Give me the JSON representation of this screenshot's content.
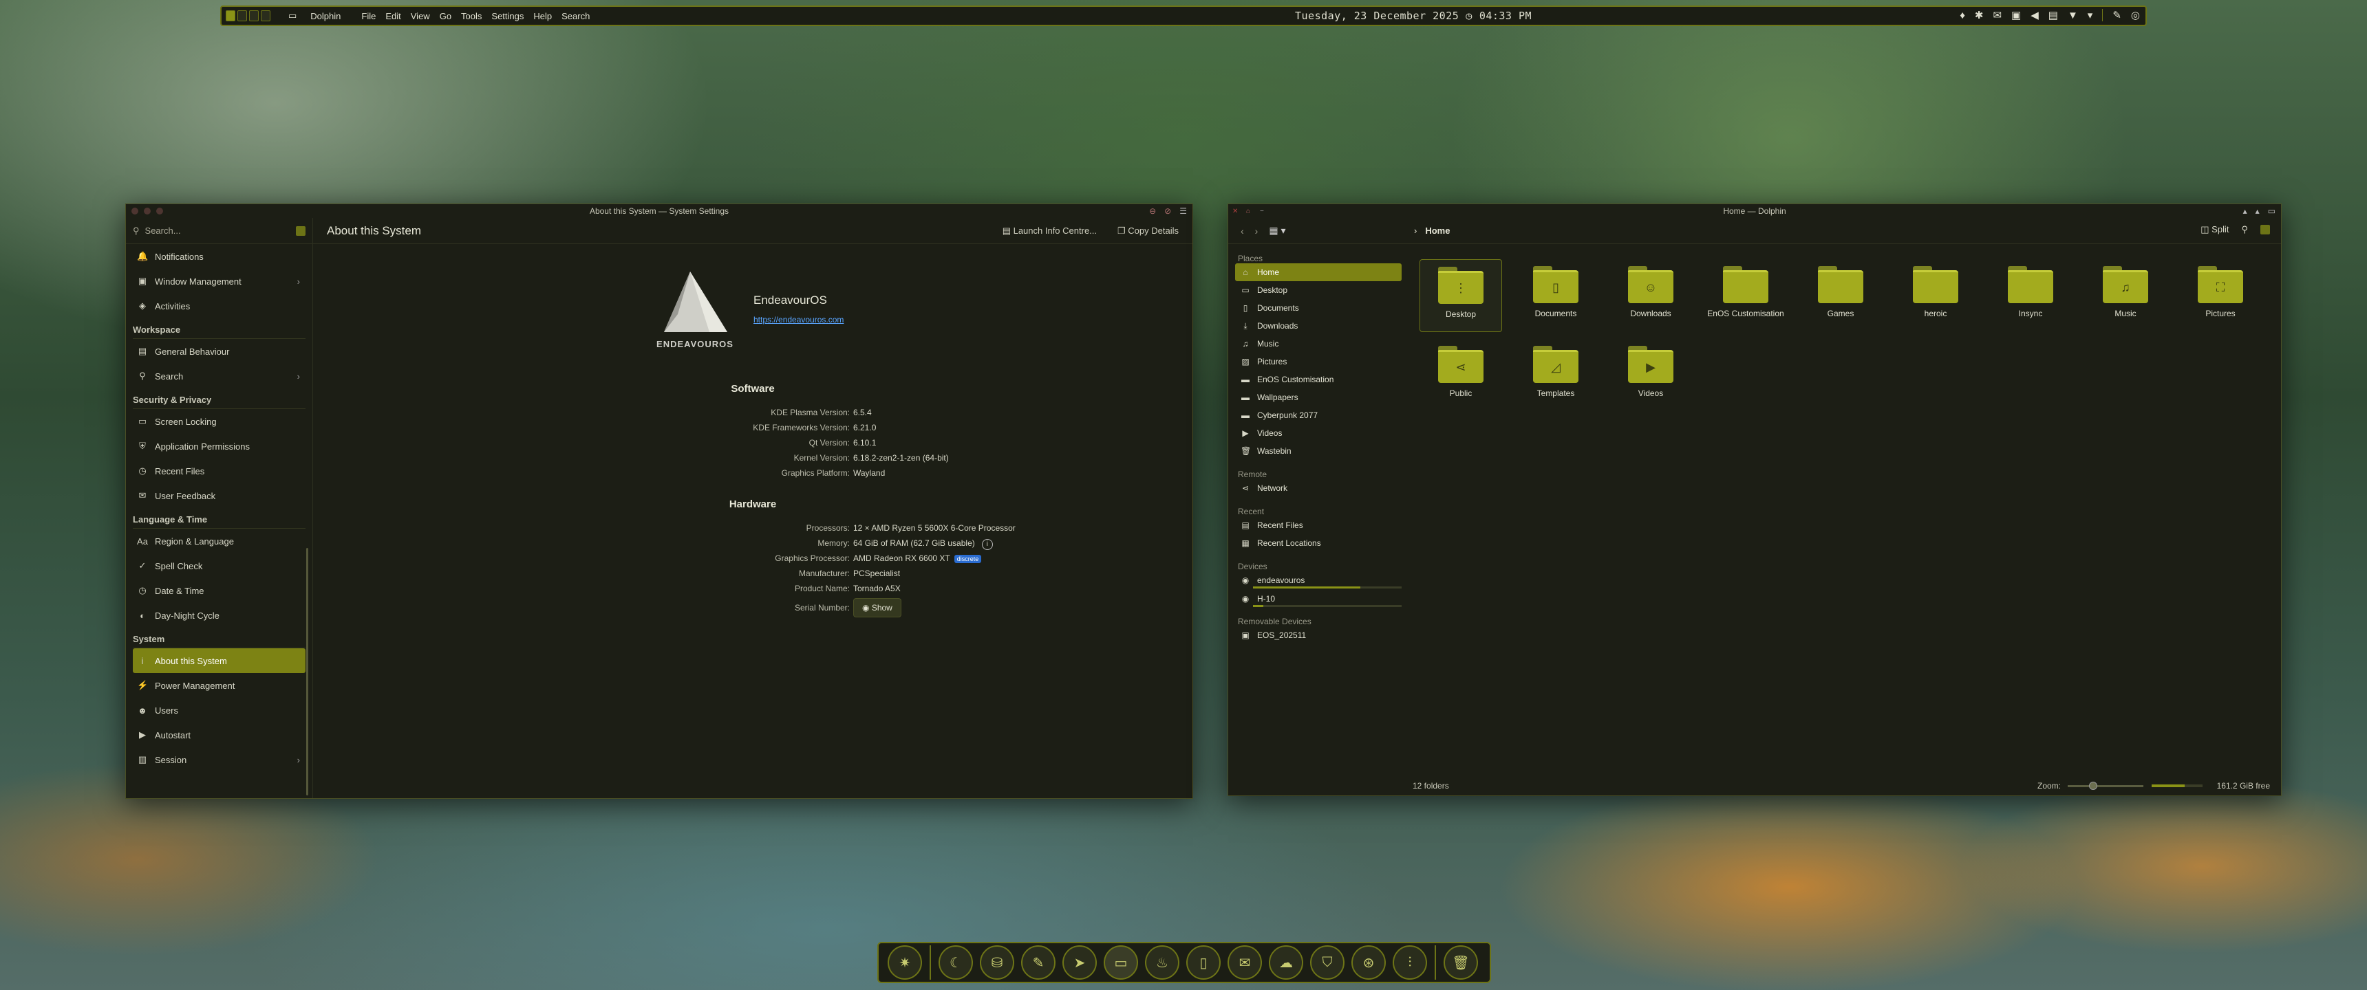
{
  "topbar": {
    "app_name": "Dolphin",
    "menu": [
      "File",
      "Edit",
      "View",
      "Go",
      "Tools",
      "Settings",
      "Help",
      "Search"
    ],
    "date": "Tuesday, 23 December 2025",
    "time": "04:33 PM"
  },
  "settings": {
    "window_title": "About this System — System Settings",
    "search_placeholder": "Search...",
    "page_title": "About this System",
    "launch_info": "Launch Info Centre...",
    "copy_details": "Copy Details",
    "sidebar": {
      "items_top": [
        {
          "label": "Notifications",
          "icon": "bell-icon"
        },
        {
          "label": "Window Management",
          "icon": "window-icon",
          "arrow": true
        },
        {
          "label": "Activities",
          "icon": "activities-icon"
        }
      ],
      "workspace_header": "Workspace",
      "workspace": [
        {
          "label": "General Behaviour",
          "icon": "general-icon"
        },
        {
          "label": "Search",
          "icon": "search-icon",
          "arrow": true
        }
      ],
      "security_header": "Security & Privacy",
      "security": [
        {
          "label": "Screen Locking",
          "icon": "screen-lock-icon"
        },
        {
          "label": "Application Permissions",
          "icon": "shield-icon"
        },
        {
          "label": "Recent Files",
          "icon": "clock-icon"
        },
        {
          "label": "User Feedback",
          "icon": "feedback-icon"
        }
      ],
      "language_header": "Language & Time",
      "language": [
        {
          "label": "Region & Language",
          "icon": "language-icon"
        },
        {
          "label": "Spell Check",
          "icon": "spell-icon"
        },
        {
          "label": "Date & Time",
          "icon": "clock-icon"
        },
        {
          "label": "Day-Night Cycle",
          "icon": "day-night-icon"
        }
      ],
      "system_header": "System",
      "system": [
        {
          "label": "About this System",
          "icon": "info-icon",
          "active": true
        },
        {
          "label": "Power Management",
          "icon": "power-icon"
        },
        {
          "label": "Users",
          "icon": "users-icon"
        },
        {
          "label": "Autostart",
          "icon": "autostart-icon"
        },
        {
          "label": "Session",
          "icon": "session-icon",
          "arrow": true
        }
      ]
    },
    "os_name": "EndeavourOS",
    "os_url": "https://endeavouros.com",
    "logo_text": "ENDEAVOUROS",
    "software_header": "Software",
    "software": [
      {
        "k": "KDE Plasma Version:",
        "v": "6.5.4"
      },
      {
        "k": "KDE Frameworks Version:",
        "v": "6.21.0"
      },
      {
        "k": "Qt Version:",
        "v": "6.10.1"
      },
      {
        "k": "Kernel Version:",
        "v": "6.18.2-zen2-1-zen (64-bit)"
      },
      {
        "k": "Graphics Platform:",
        "v": "Wayland"
      }
    ],
    "hardware_header": "Hardware",
    "hardware": {
      "processors_k": "Processors:",
      "processors_v": "12 × AMD Ryzen 5 5600X 6-Core Processor",
      "memory_k": "Memory:",
      "memory_v": "64 GiB of RAM (62.7 GiB usable)",
      "gpu_k": "Graphics Processor:",
      "gpu_v": "AMD Radeon RX 6600 XT",
      "gpu_badge": "discrete",
      "manufacturer_k": "Manufacturer:",
      "manufacturer_v": "PCSpecialist",
      "product_k": "Product Name:",
      "product_v": "Tornado A5X",
      "serial_k": "Serial Number:",
      "serial_btn": "Show"
    }
  },
  "dolphin": {
    "window_title": "Home — Dolphin",
    "breadcrumb": "Home",
    "split_label": "Split",
    "places_header": "Places",
    "places": [
      {
        "label": "Home",
        "icon": "home-icon",
        "active": true
      },
      {
        "label": "Desktop",
        "icon": "desktop-icon"
      },
      {
        "label": "Documents",
        "icon": "documents-icon"
      },
      {
        "label": "Downloads",
        "icon": "downloads-icon"
      },
      {
        "label": "Music",
        "icon": "music-icon"
      },
      {
        "label": "Pictures",
        "icon": "pictures-icon"
      },
      {
        "label": "EnOS Customisation",
        "icon": "folder-icon"
      },
      {
        "label": "Wallpapers",
        "icon": "folder-icon"
      },
      {
        "label": "Cyberpunk 2077",
        "icon": "folder-icon"
      },
      {
        "label": "Videos",
        "icon": "videos-icon"
      },
      {
        "label": "Wastebin",
        "icon": "trash-icon"
      }
    ],
    "remote_header": "Remote",
    "remote": [
      {
        "label": "Network",
        "icon": "network-icon"
      }
    ],
    "recent_header": "Recent",
    "recent": [
      {
        "label": "Recent Files",
        "icon": "recent-files-icon"
      },
      {
        "label": "Recent Locations",
        "icon": "recent-locations-icon"
      }
    ],
    "devices_header": "Devices",
    "devices": [
      {
        "label": "endeavouros",
        "icon": "drive-icon",
        "used": 0.72
      },
      {
        "label": "H-10",
        "icon": "drive-icon",
        "used": 0.07
      }
    ],
    "removable_header": "Removable Devices",
    "removable": [
      {
        "label": "EOS_202511",
        "icon": "usb-icon"
      }
    ],
    "folders": [
      {
        "name": "Desktop",
        "glyph": "⋮",
        "selected": true
      },
      {
        "name": "Documents",
        "glyph": "▯"
      },
      {
        "name": "Downloads",
        "glyph": "☺"
      },
      {
        "name": "EnOS Customisation",
        "glyph": ""
      },
      {
        "name": "Games",
        "glyph": ""
      },
      {
        "name": "heroic",
        "glyph": ""
      },
      {
        "name": "Insync",
        "glyph": ""
      },
      {
        "name": "Music",
        "glyph": "♫"
      },
      {
        "name": "Pictures",
        "glyph": "⛶"
      },
      {
        "name": "Public",
        "glyph": "⋖"
      },
      {
        "name": "Templates",
        "glyph": "◿"
      },
      {
        "name": "Videos",
        "glyph": "▶"
      }
    ],
    "status_count": "12 folders",
    "zoom_label": "Zoom:",
    "zoom_level": 0.28,
    "free_space": "161.2 GiB free",
    "used_fraction": 0.65
  },
  "dock": {
    "items": [
      "app-launcher-icon",
      "night-icon",
      "store-icon",
      "notes-icon",
      "telegram-icon",
      "files-icon",
      "flame-icon",
      "document-icon",
      "mail-icon",
      "weather-icon",
      "vpn-icon",
      "steam-icon",
      "mixer-icon",
      "trash-icon"
    ]
  }
}
